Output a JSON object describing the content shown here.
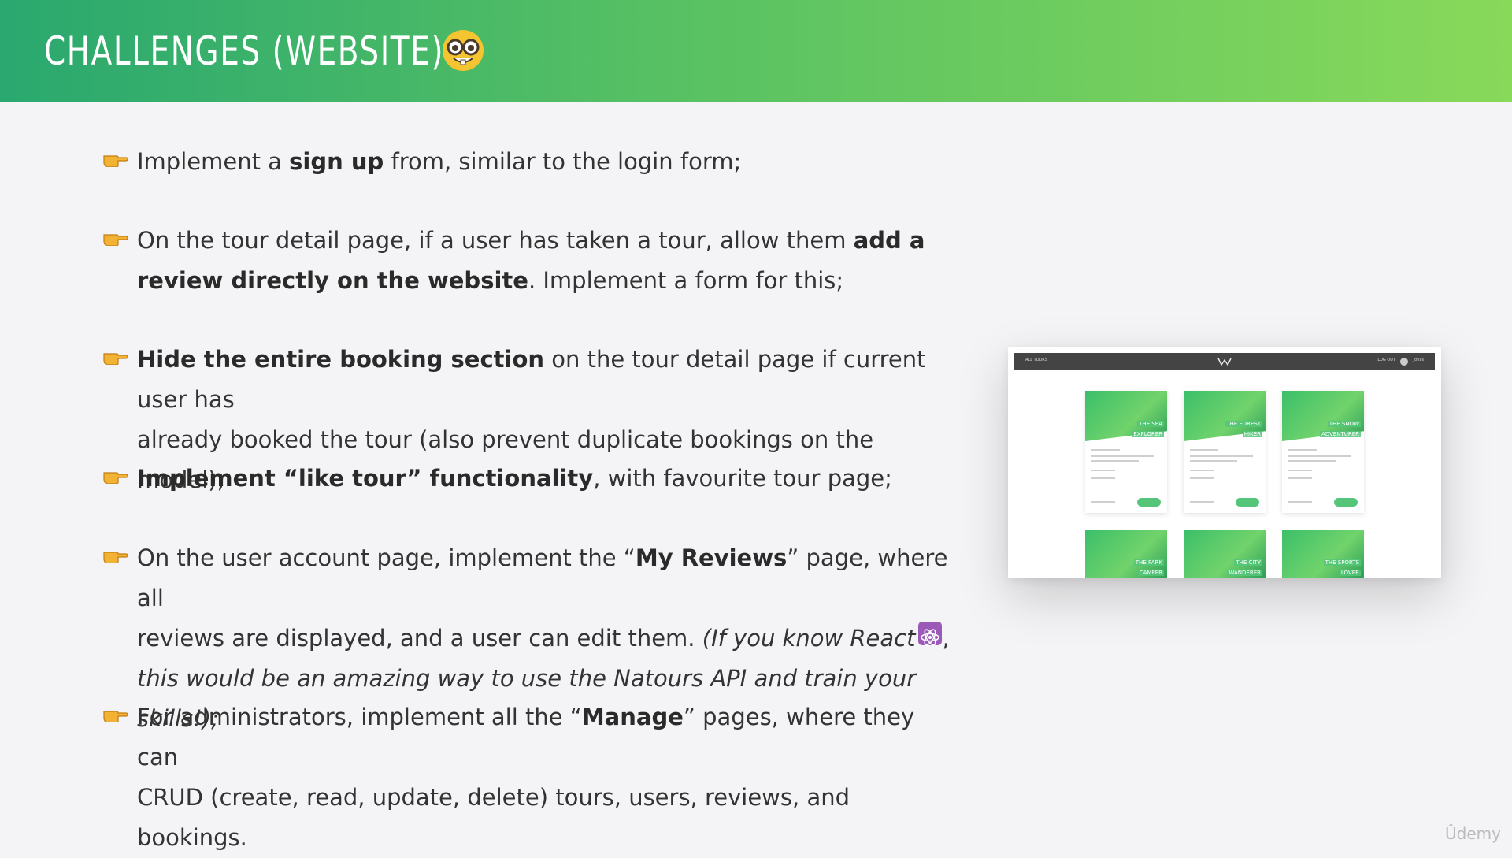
{
  "header": {
    "title": "CHALLENGES (WEBSITE)",
    "emoji": "nerd-face-icon"
  },
  "bullets": [
    {
      "icon": "pointing-hand-icon",
      "line1": {
        "t1": "Implement a ",
        "b1": "sign up",
        "t2": " from, similar to the login form;"
      }
    },
    {
      "icon": "pointing-hand-icon",
      "line1": {
        "t1": "On the tour detail page, if a user has taken a tour, allow them ",
        "b1": "add a"
      },
      "line2": {
        "b1": "review directly on the website",
        "t1": ". Implement a form for this;"
      }
    },
    {
      "icon": "pointing-hand-icon",
      "line1": {
        "b1": "Hide the entire booking section",
        "t1": " on the tour detail page if current user has"
      },
      "line2": {
        "t1": "already booked the tour (also prevent duplicate bookings on the model);"
      }
    },
    {
      "icon": "pointing-hand-icon",
      "line1": {
        "b1": "Implement “like tour” functionality",
        "t1": ", with favourite tour page;"
      }
    },
    {
      "icon": "pointing-hand-icon",
      "line1": {
        "t1": "On the user account page, implement the “",
        "b1": "My Reviews",
        "t2": "” page, where all"
      },
      "line2": {
        "t1": "reviews are displayed, and a user can edit them. ",
        "i1": "(If you know React",
        "t2": ","
      },
      "line3": {
        "i1": "this would be an amazing way to use the Natours API and train your skills!);"
      }
    },
    {
      "icon": "pointing-hand-icon",
      "line1": {
        "t1": "For administrators, implement all the “",
        "b1": "Manage",
        "t2": "” pages, where they can"
      },
      "line2": {
        "t1": "CRUD (create, read, update, delete) tours, users, reviews, and bookings."
      }
    }
  ],
  "preview": {
    "nav_left": "ALL TOURS",
    "nav_logout": "LOG OUT",
    "nav_user": "Jonas",
    "cards_top": [
      {
        "title_l1": "THE SEA",
        "title_l2": "EXPLORER"
      },
      {
        "title_l1": "THE FOREST",
        "title_l2": "HIKER"
      },
      {
        "title_l1": "THE SNOW",
        "title_l2": "ADVENTURER"
      }
    ],
    "cards_bottom": [
      {
        "title_l1": "THE PARK",
        "title_l2": "CAMPER"
      },
      {
        "title_l1": "THE CITY",
        "title_l2": "WANDERER"
      },
      {
        "title_l1": "THE SPORTS",
        "title_l2": "LOVER"
      }
    ]
  },
  "watermark": "Ûdemy"
}
